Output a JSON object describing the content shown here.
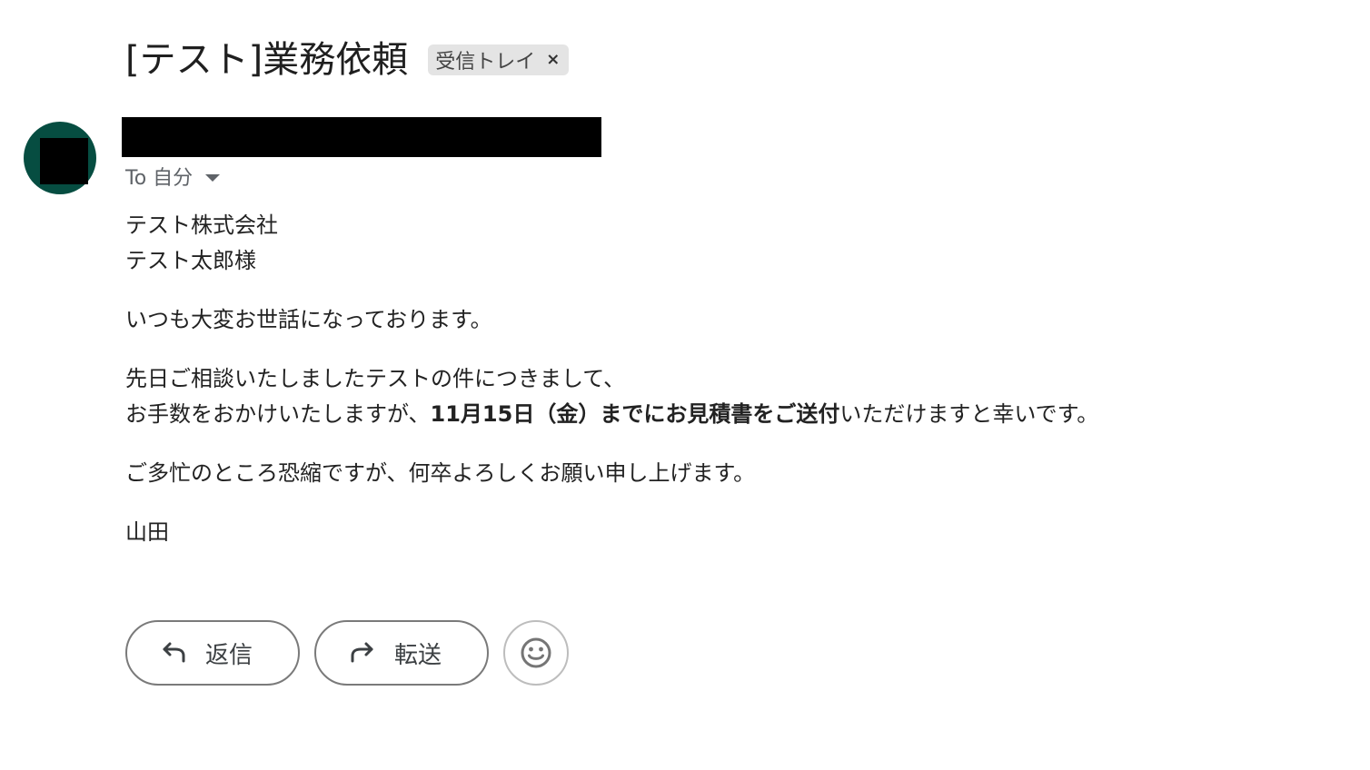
{
  "email": {
    "subject": "[テスト]業務依頼",
    "label": "受信トレイ",
    "label_close": "×",
    "to_text": "To 自分"
  },
  "body": {
    "greeting": [
      "テスト株式会社",
      "テスト太郎様"
    ],
    "intro": "いつも大変お世話になっております。",
    "request_line1": "先日ご相談いたしましたテストの件につきまして、",
    "request_line2_pre": "お手数をおかけいたしますが、",
    "request_line2_bold": "11月15日（金）までにお見積書をご送付",
    "request_line2_post": "いただけますと幸いです。",
    "closing": "ご多忙のところ恐縮ですが、何卒よろしくお願い申し上げます。",
    "signature": "山田"
  },
  "actions": {
    "reply_label": "返信",
    "forward_label": "転送"
  },
  "icons": {
    "reply": "reply-arrow-icon",
    "forward": "forward-arrow-icon",
    "emoji": "smiley-icon",
    "dropdown": "caret-down-icon"
  },
  "colors": {
    "avatar": "#064d41",
    "chip_bg": "#e4e4e4",
    "redaction": "#000000"
  }
}
